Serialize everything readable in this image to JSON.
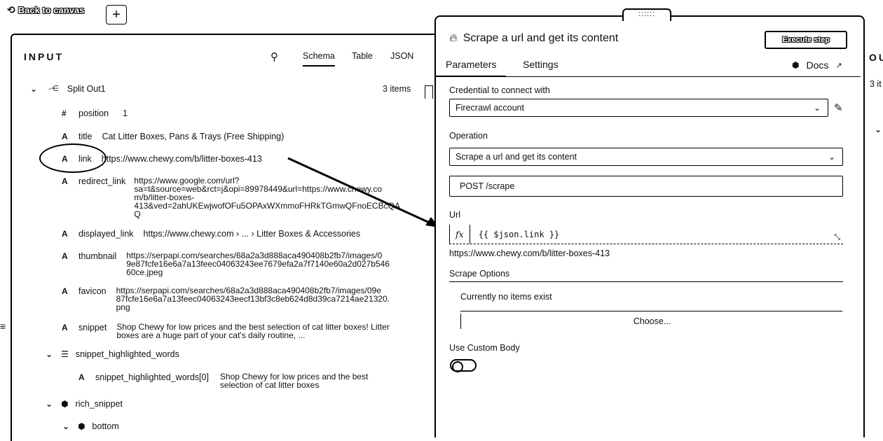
{
  "topbar": {
    "back_label": "Back to canvas",
    "add_label": "+"
  },
  "input": {
    "title": "INPUT",
    "tabs": [
      "Schema",
      "Table",
      "JSON"
    ],
    "node_name": "Split Out1",
    "item_count": "3 items",
    "fields": {
      "position": {
        "name": "position",
        "value": "1"
      },
      "title": {
        "name": "title",
        "value": "Cat Litter Boxes, Pans & Trays (Free Shipping)"
      },
      "link": {
        "name": "link",
        "value": "https://www.chewy.com/b/litter-boxes-413"
      },
      "redirect_link": {
        "name": "redirect_link",
        "value": "https://www.google.com/url?\nsa=t&source=web&rct=j&opi=89978449&url=https://www.chewy.co\nm/b/litter-boxes-\n413&ved=2ahUKEwjwofOFu5OPAxWXmmoFHRkTGmwQFnoECBcQA\nQ"
      },
      "displayed_link": {
        "name": "displayed_link",
        "value": "https://www.chewy.com › ... › Litter Boxes & Accessories"
      },
      "thumbnail": {
        "name": "thumbnail",
        "value": "https://serpapi.com/searches/68a2a3d888aca490408b2fb7/images/0\n9e87fcfe16e6a7a13feec04063243ee7679efa2a7f7140e60a2d027b546\n60ce.jpeg"
      },
      "favicon": {
        "name": "favicon",
        "value": "https://serpapi.com/searches/68a2a3d888aca490408b2fb7/images/09e\n87fcfe16e6a7a13feec04063243eecf13bf3c8eb624d8d39ca7214ae21320.\npng"
      },
      "snippet": {
        "name": "snippet",
        "value": "Shop Chewy for low prices and the best selection of cat litter boxes! Litter\nboxes are a huge part of your cat's daily routine, ..."
      },
      "snippet_highlighted_words": {
        "name": "snippet_highlighted_words"
      },
      "snippet_highlighted_words_0": {
        "name": "snippet_highlighted_words[0]",
        "value": "Shop Chewy for low prices and the best\nselection of cat litter boxes"
      },
      "rich_snippet": {
        "name": "rich_snippet"
      },
      "bottom": {
        "name": "bottom"
      }
    },
    "type_labels": {
      "number": "#",
      "string": "A"
    }
  },
  "params": {
    "node_title": "Scrape a url and get its content",
    "execute_label": "Execute step",
    "tabs": {
      "parameters": "Parameters",
      "settings": "Settings",
      "docs": "Docs"
    },
    "credential_label": "Credential to connect with",
    "credential_value": "Firecrawl account",
    "operation_label": "Operation",
    "operation_value": "Scrape a url and get its content",
    "endpoint": "POST /scrape",
    "url_label": "Url",
    "url_fx": "fx",
    "url_expression": "{{ $json.link }}",
    "url_preview": "https://www.chewy.com/b/litter-boxes-413",
    "scrape_options_label": "Scrape Options",
    "no_items": "Currently no items exist",
    "choose_label": "Choose...",
    "custom_body_label": "Use Custom Body"
  },
  "output": {
    "title_fragment": "OU",
    "count_fragment": "3 it"
  }
}
